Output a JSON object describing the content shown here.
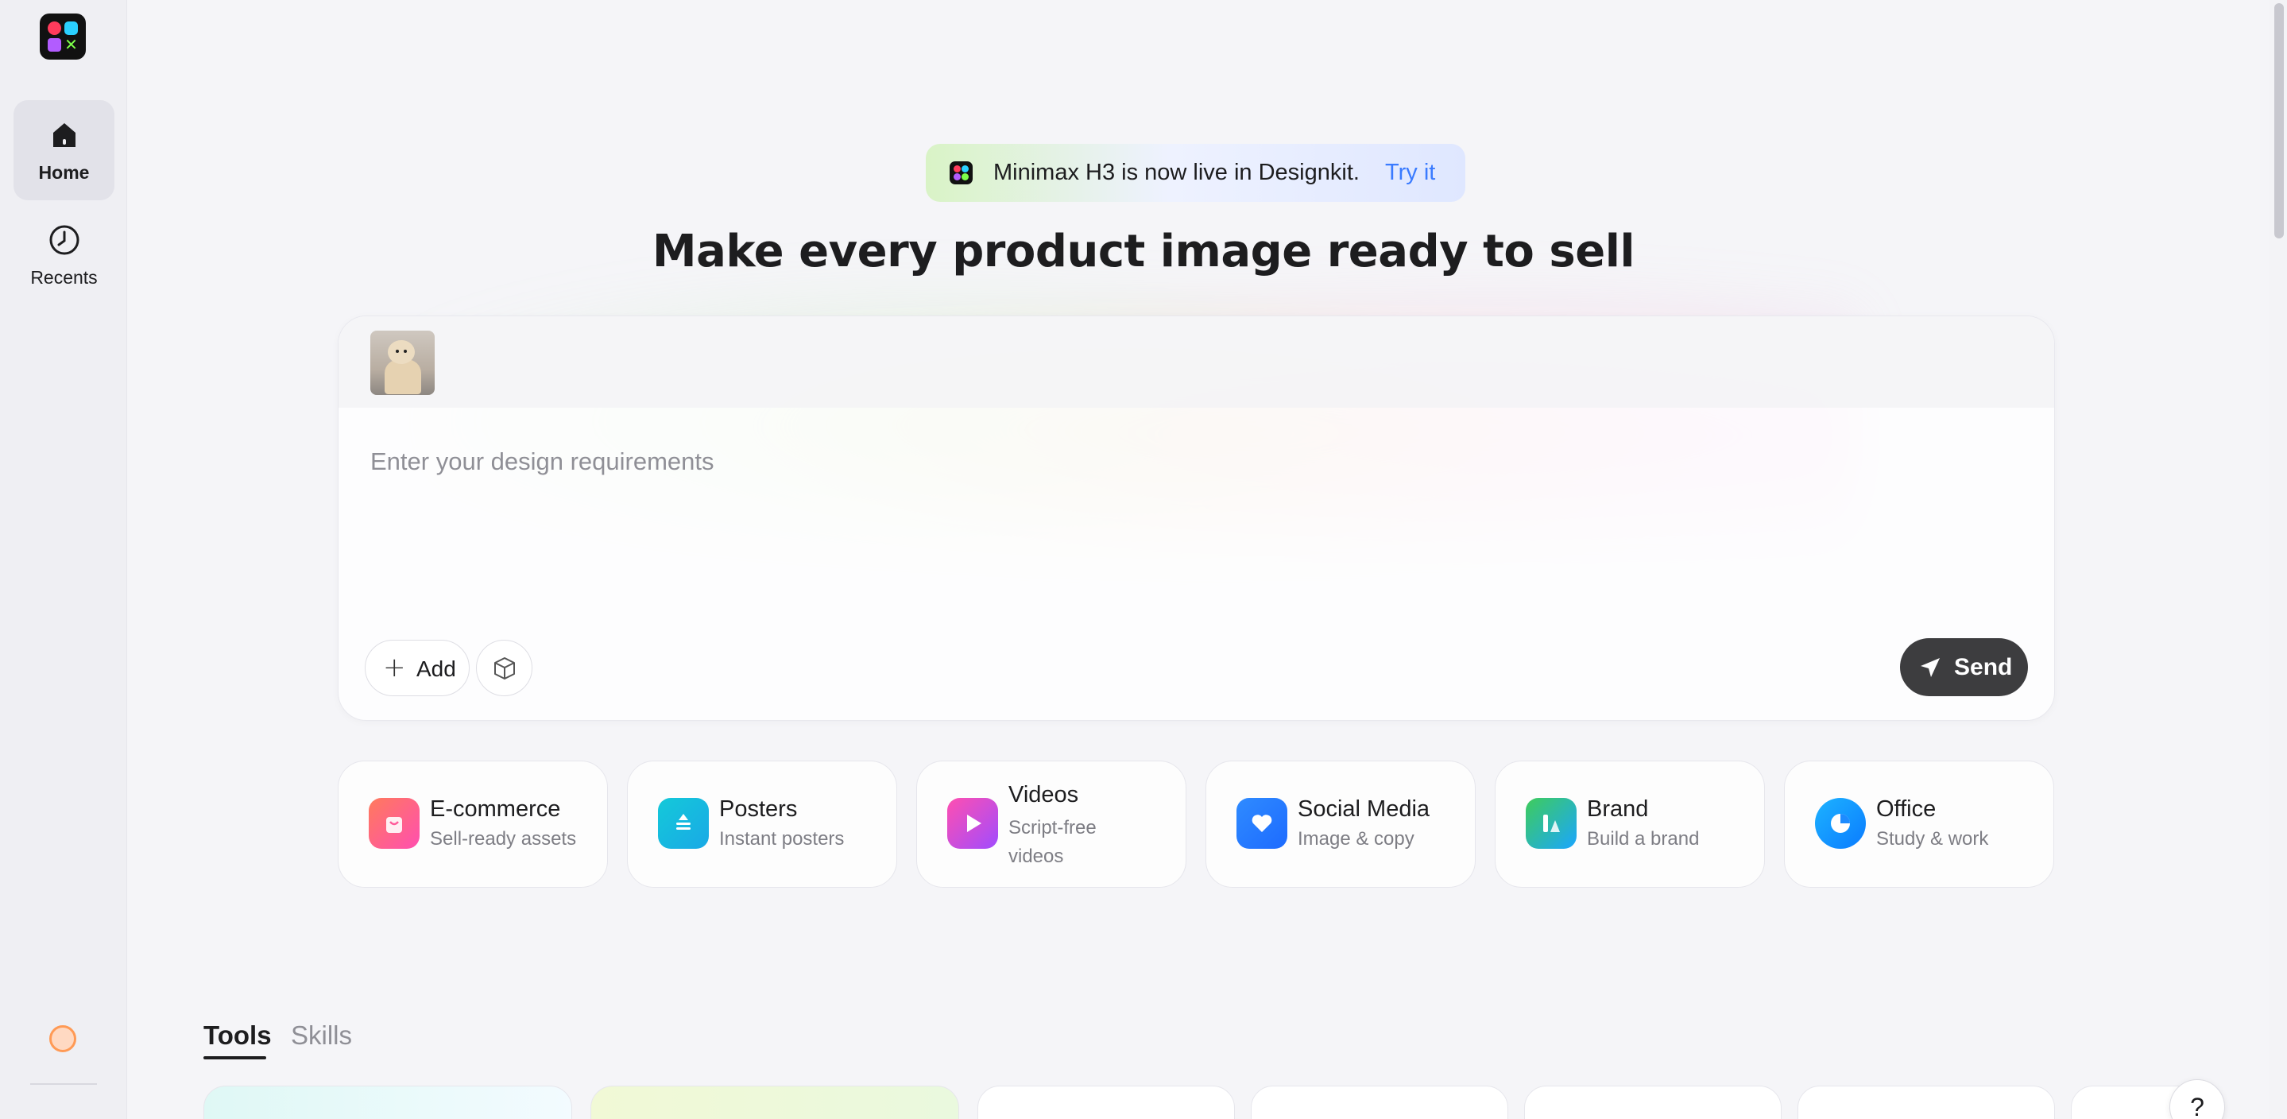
{
  "sidebar": {
    "items": [
      {
        "label": "Home",
        "icon": "home-icon",
        "active": true
      },
      {
        "label": "Recents",
        "icon": "clock-icon",
        "active": false
      }
    ]
  },
  "banner": {
    "text": "Minimax H3 is now live in Designkit.",
    "link": "Try it"
  },
  "headline": "Make every product image ready to sell",
  "composer": {
    "placeholder": "Enter your design requirements",
    "add_label": "Add",
    "send_label": "Send"
  },
  "categories": [
    {
      "title": "E-commerce",
      "subtitle": "Sell-ready assets",
      "icon": "shopping-bag-icon"
    },
    {
      "title": "Posters",
      "subtitle": "Instant posters",
      "icon": "poster-icon"
    },
    {
      "title": "Videos",
      "subtitle": "Script-free videos",
      "icon": "play-icon"
    },
    {
      "title": "Social Media",
      "subtitle": "Image & copy",
      "icon": "heart-icon"
    },
    {
      "title": "Brand",
      "subtitle": "Build a brand",
      "icon": "brand-icon"
    },
    {
      "title": "Office",
      "subtitle": "Study & work",
      "icon": "pie-chart-icon"
    }
  ],
  "tabs": [
    {
      "label": "Tools",
      "active": true
    },
    {
      "label": "Skills",
      "active": false
    }
  ],
  "help": {
    "label": "?"
  },
  "colors": {
    "accent": "#3a7bff",
    "send_bg": "#3d3d3f",
    "sidebar_bg": "#efeff3"
  }
}
